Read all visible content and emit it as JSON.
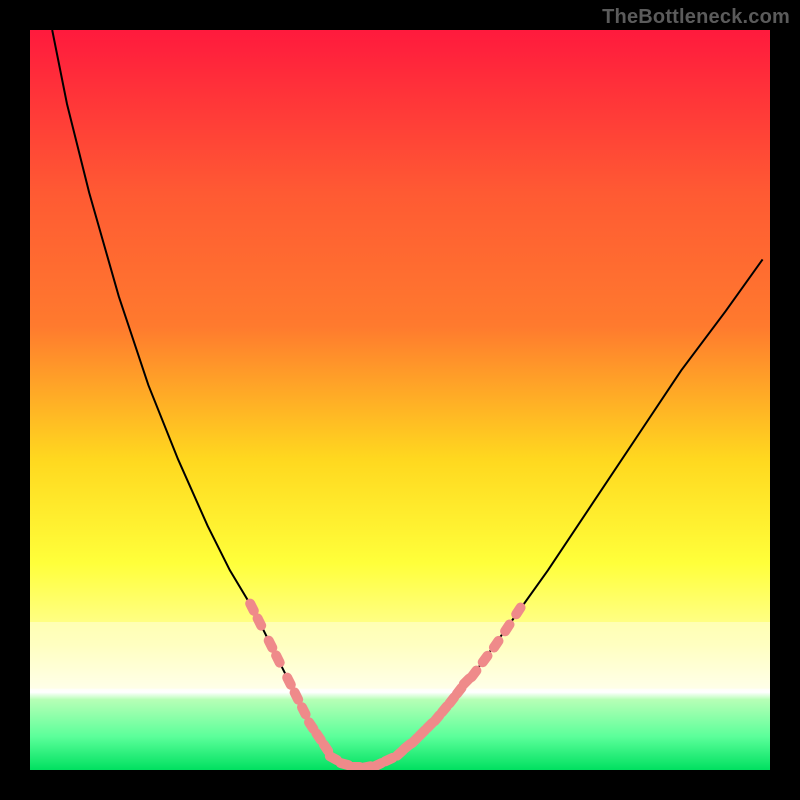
{
  "watermark": "TheBottleneck.com",
  "colors": {
    "black": "#000000",
    "gradient_top": "#ff1a3d",
    "gradient_mid1": "#ff7a2e",
    "gradient_mid2": "#ffd81f",
    "gradient_yellow": "#ffff3a",
    "gradient_ylight": "#ffff9e",
    "gradient_green_light": "#b6ffb6",
    "gradient_green": "#00e060",
    "curve": "#000000",
    "marker": "#ef8a8a"
  },
  "chart_data": {
    "type": "line",
    "title": "",
    "xlabel": "",
    "ylabel": "",
    "xlim": [
      0,
      100
    ],
    "ylim": [
      0,
      100
    ],
    "grid": false,
    "annotations": [
      "TheBottleneck.com"
    ],
    "series": [
      {
        "name": "bottleneck-curve",
        "x": [
          3,
          5,
          8,
          12,
          16,
          20,
          24,
          27,
          30,
          32,
          34,
          36,
          37.5,
          39,
          40.5,
          42,
          44,
          46,
          49,
          52,
          56,
          60,
          65,
          70,
          76,
          82,
          88,
          94,
          99
        ],
        "y": [
          100,
          90,
          78,
          64,
          52,
          42,
          33,
          27,
          22,
          18,
          14,
          10,
          7,
          4.5,
          2.5,
          1.2,
          0.4,
          0.5,
          1.6,
          4,
          8,
          13,
          20,
          27,
          36,
          45,
          54,
          62,
          69
        ]
      }
    ],
    "markers": [
      {
        "name": "left-branch-highlight",
        "kind": "dash",
        "points": [
          {
            "x": 30.0,
            "y": 22.0
          },
          {
            "x": 31.0,
            "y": 20.0
          },
          {
            "x": 32.5,
            "y": 17.0
          },
          {
            "x": 33.5,
            "y": 15.0
          },
          {
            "x": 35.0,
            "y": 12.0
          },
          {
            "x": 36.0,
            "y": 10.0
          },
          {
            "x": 37.0,
            "y": 8.0
          },
          {
            "x": 38.0,
            "y": 6.0
          },
          {
            "x": 39.0,
            "y": 4.5
          },
          {
            "x": 40.0,
            "y": 3.0
          }
        ]
      },
      {
        "name": "valley-highlight",
        "kind": "dash",
        "points": [
          {
            "x": 41.0,
            "y": 1.6
          },
          {
            "x": 42.5,
            "y": 0.8
          },
          {
            "x": 44.0,
            "y": 0.4
          },
          {
            "x": 45.5,
            "y": 0.4
          },
          {
            "x": 47.0,
            "y": 0.7
          },
          {
            "x": 48.5,
            "y": 1.4
          }
        ]
      },
      {
        "name": "right-branch-highlight",
        "kind": "dash",
        "points": [
          {
            "x": 50.0,
            "y": 2.3
          },
          {
            "x": 51.0,
            "y": 3.2
          },
          {
            "x": 52.0,
            "y": 4.0
          },
          {
            "x": 53.0,
            "y": 5.0
          },
          {
            "x": 54.0,
            "y": 6.0
          },
          {
            "x": 55.0,
            "y": 7.0
          },
          {
            "x": 56.0,
            "y": 8.2
          },
          {
            "x": 57.0,
            "y": 9.4
          },
          {
            "x": 58.0,
            "y": 10.7
          },
          {
            "x": 59.0,
            "y": 12.0
          },
          {
            "x": 60.0,
            "y": 13.0
          },
          {
            "x": 61.5,
            "y": 15.0
          },
          {
            "x": 63.0,
            "y": 17.0
          },
          {
            "x": 64.5,
            "y": 19.2
          },
          {
            "x": 66.0,
            "y": 21.5
          }
        ]
      }
    ]
  }
}
